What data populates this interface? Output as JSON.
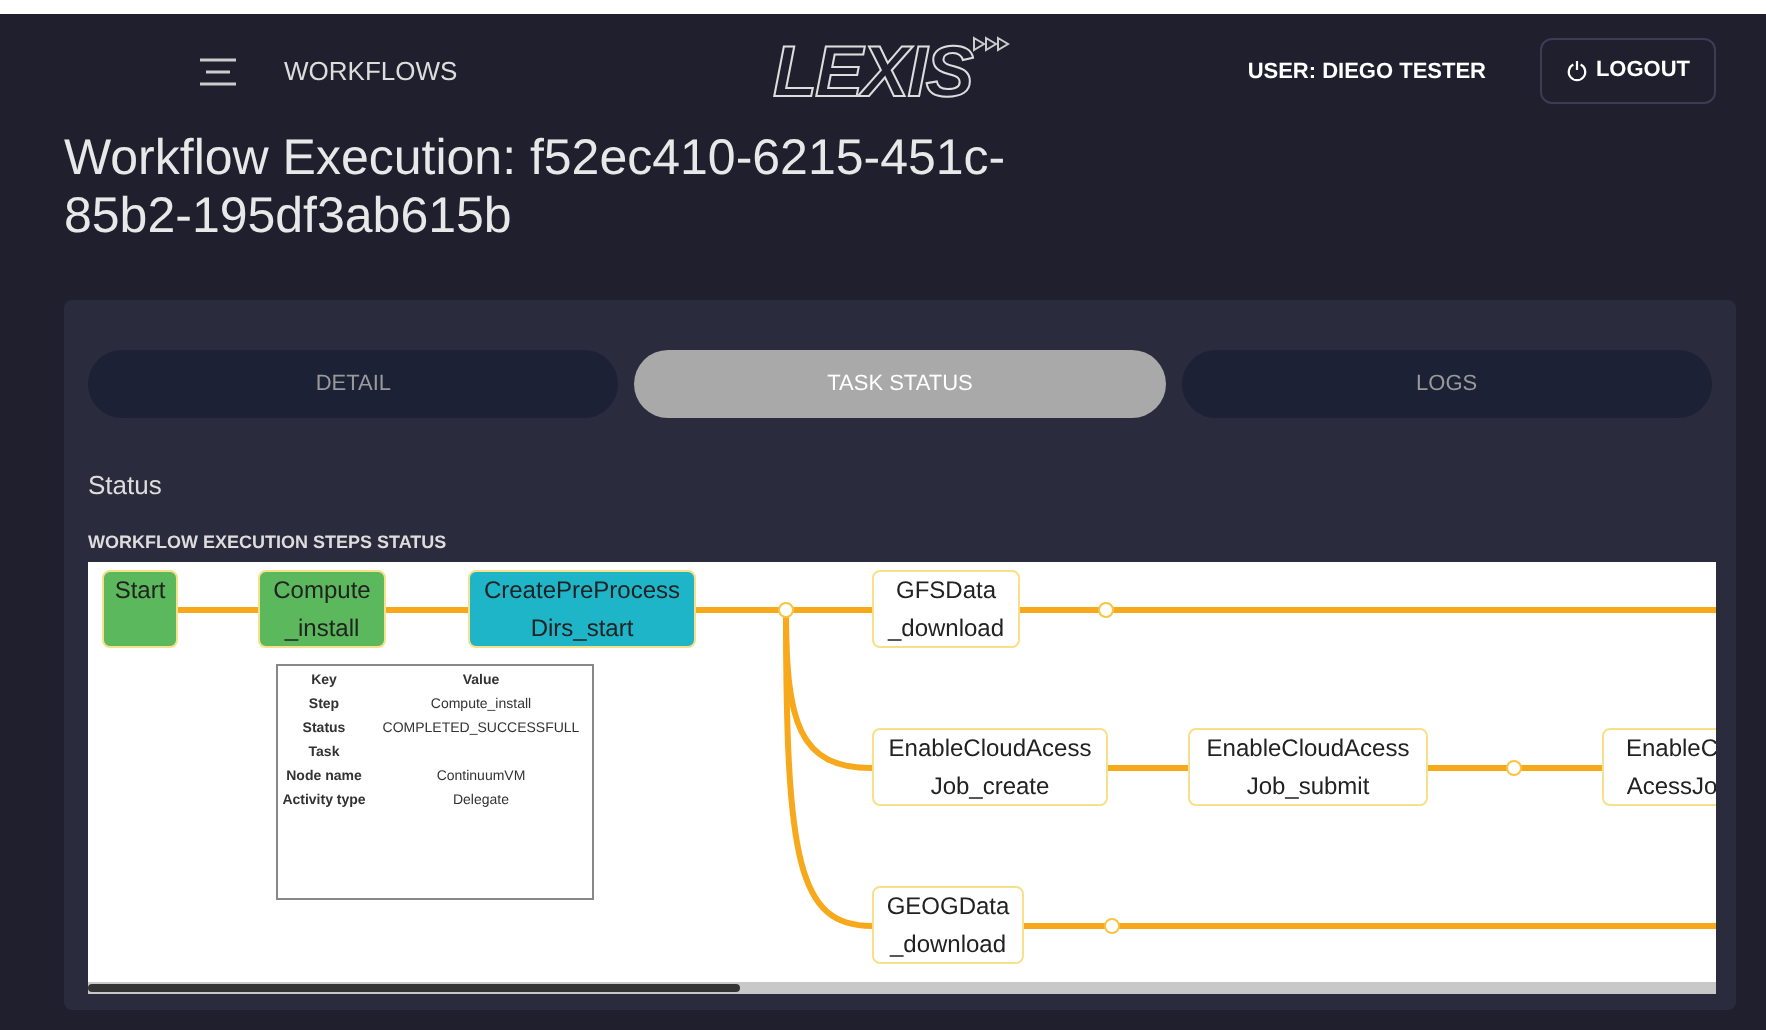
{
  "header": {
    "menu_label": "WORKFLOWS",
    "logo": "LEXIS",
    "user": "USER: DIEGO TESTER",
    "logout": "LOGOUT"
  },
  "title": "Workflow Execution: f52ec410-6215-451c-85b2-195df3ab615b",
  "tabs": [
    {
      "label": "DETAIL",
      "selected": false
    },
    {
      "label": "TASK STATUS",
      "selected": true
    },
    {
      "label": "LOGS",
      "selected": false
    }
  ],
  "section_title": "Status",
  "diagram_title": "WORKFLOW EXECUTION STEPS STATUS",
  "nodes": [
    {
      "lines": [
        "Start"
      ],
      "color": "#5cb85c"
    },
    {
      "lines": [
        "Compute",
        "_install"
      ],
      "color": "#5cb85c"
    },
    {
      "lines": [
        "CreatePreProcess",
        "Dirs_start"
      ],
      "color": "#1fb5c9"
    },
    {
      "lines": [
        "GFSData",
        "_download"
      ],
      "color": "#ffffff"
    },
    {
      "lines": [
        "EnableCloudAcess",
        "Job_create"
      ],
      "color": "#ffffff"
    },
    {
      "lines": [
        "EnableCloudAcess",
        "Job_submit"
      ],
      "color": "#ffffff"
    },
    {
      "lines": [
        "EnableC",
        "AcessJo"
      ],
      "color": "#ffffff"
    },
    {
      "lines": [
        "GEOGData",
        "_download"
      ],
      "color": "#ffffff"
    }
  ],
  "tooltip": {
    "columns": [
      "Key",
      "Value"
    ],
    "rows": [
      {
        "key": "Step",
        "value": "Compute_install"
      },
      {
        "key": "Status",
        "value": "COMPLETED_SUCCESSFULL"
      },
      {
        "key": "Task"
      },
      {
        "key": "Node name",
        "value": "ContinuumVM"
      },
      {
        "key": "Activity type",
        "value": "Delegate"
      }
    ]
  }
}
